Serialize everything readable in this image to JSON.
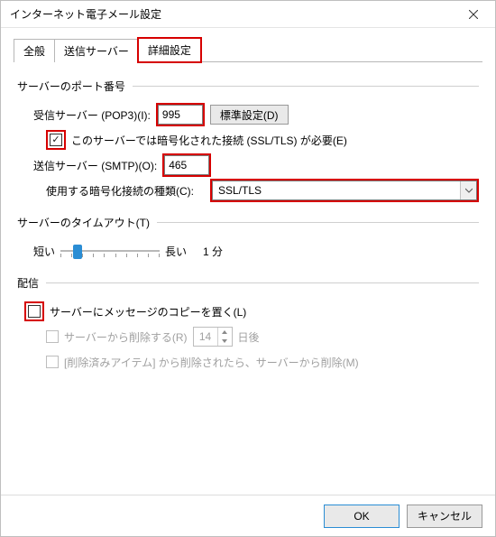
{
  "window": {
    "title": "インターネット電子メール設定"
  },
  "tabs": {
    "general": "全般",
    "outgoing": "送信サーバー",
    "advanced": "詳細設定"
  },
  "ports": {
    "group_label": "サーバーのポート番号",
    "pop3_label": "受信サーバー (POP3)(I):",
    "pop3_value": "995",
    "defaults_btn": "標準設定(D)",
    "pop3_ssl_label": "このサーバーでは暗号化された接続 (SSL/TLS) が必要(E)",
    "smtp_label": "送信サーバー (SMTP)(O):",
    "smtp_value": "465",
    "enc_label": "使用する暗号化接続の種類(C):",
    "enc_value": "SSL/TLS"
  },
  "timeout": {
    "group_label": "サーバーのタイムアウト(T)",
    "short": "短い",
    "long": "長い",
    "value": "1 分"
  },
  "delivery": {
    "group_label": "配信",
    "leave_copy_label": "サーバーにメッセージのコピーを置く(L)",
    "remove_after_label": "サーバーから削除する(R)",
    "remove_after_days": "14",
    "days_suffix": "日後",
    "remove_deleted_label": "[削除済みアイテム] から削除されたら、サーバーから削除(M)"
  },
  "buttons": {
    "ok": "OK",
    "cancel": "キャンセル"
  }
}
